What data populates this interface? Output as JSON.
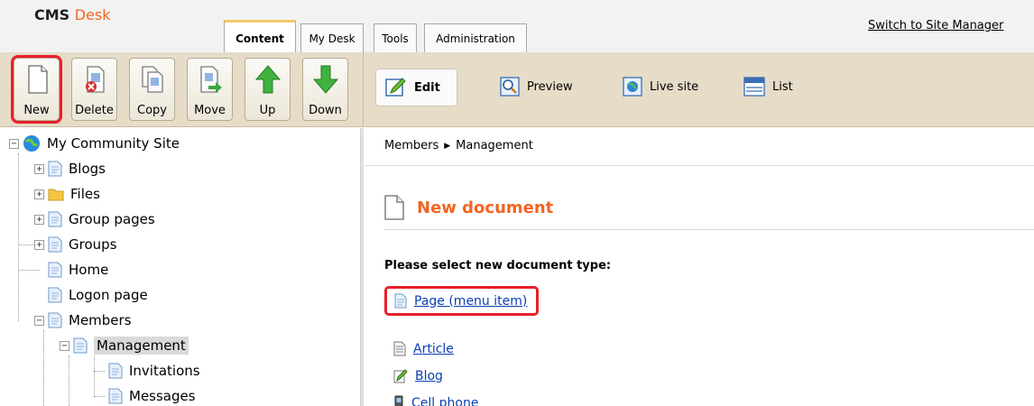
{
  "header": {
    "brand_cms": "CMS",
    "brand_desk": "Desk",
    "tabs": [
      {
        "label": "Content",
        "active": true
      },
      {
        "label": "My Desk",
        "active": false
      },
      {
        "label": "Tools",
        "active": false
      },
      {
        "label": "Administration",
        "active": false
      }
    ],
    "switch_link": "Switch to Site Manager"
  },
  "toolbar": {
    "buttons": [
      {
        "label": "New",
        "icon": "new-document-icon",
        "highlighted": true
      },
      {
        "label": "Delete",
        "icon": "delete-document-icon",
        "highlighted": false
      },
      {
        "label": "Copy",
        "icon": "copy-document-icon",
        "highlighted": false
      },
      {
        "label": "Move",
        "icon": "move-document-icon",
        "highlighted": false
      },
      {
        "label": "Up",
        "icon": "arrow-up-icon",
        "highlighted": false
      },
      {
        "label": "Down",
        "icon": "arrow-down-icon",
        "highlighted": false
      }
    ],
    "view_modes": [
      {
        "label": "Edit",
        "icon": "pencil-edit-icon",
        "active": true
      },
      {
        "label": "Preview",
        "icon": "magnifier-preview-icon",
        "active": false
      },
      {
        "label": "Live site",
        "icon": "globe-live-icon",
        "active": false
      },
      {
        "label": "List",
        "icon": "list-view-icon",
        "active": false
      }
    ]
  },
  "tree": {
    "root": "My Community Site",
    "items": [
      {
        "label": "Blogs"
      },
      {
        "label": "Files"
      },
      {
        "label": "Group pages"
      },
      {
        "label": "Groups"
      },
      {
        "label": "Home"
      },
      {
        "label": "Logon page"
      },
      {
        "label": "Members"
      },
      {
        "label": "Management"
      },
      {
        "label": "Invitations"
      },
      {
        "label": "Messages"
      }
    ]
  },
  "content": {
    "breadcrumb": [
      "Members",
      "Management"
    ],
    "title": "New document",
    "select_label": "Please select new document type:",
    "doc_types": [
      {
        "label": "Page (menu item)",
        "highlighted": true
      },
      {
        "label": "Article",
        "highlighted": false
      },
      {
        "label": "Blog",
        "highlighted": false
      },
      {
        "label": "Cell phone",
        "highlighted": false
      }
    ]
  },
  "colors": {
    "brand_orange": "#f26522",
    "toolbar_bg": "#e6dcc8",
    "highlight_red": "#e8202a",
    "link_blue": "#0b3fb5"
  }
}
